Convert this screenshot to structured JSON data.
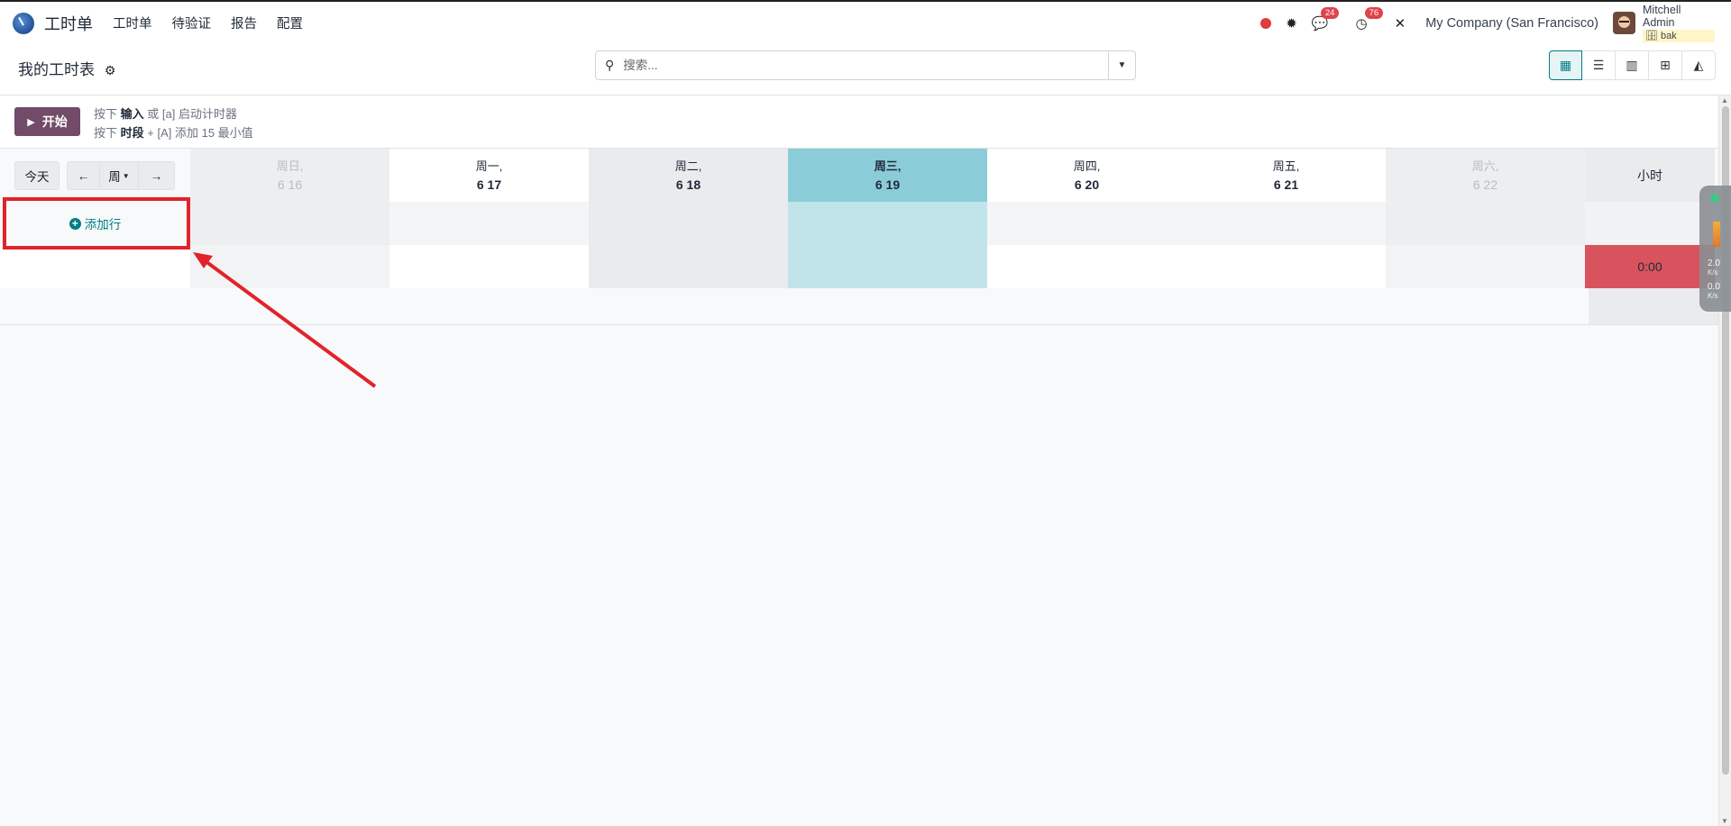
{
  "app": {
    "title": "工时单",
    "menu": [
      "工时单",
      "待验证",
      "报告",
      "配置"
    ]
  },
  "systray": {
    "messages_badge": "24",
    "activities_badge": "76",
    "company": "My Company (San Francisco)",
    "user_name": "Mitchell Admin",
    "db_name": "bak"
  },
  "controlpanel": {
    "title": "我的工时表",
    "search_placeholder": "搜索..."
  },
  "timer": {
    "start_label": "开始",
    "hint1_prefix": "按下",
    "hint1_key": "输入",
    "hint1_suffix": "或 [a] 启动计时器",
    "hint2_prefix": "按下",
    "hint2_key": "时段",
    "hint2_suffix": "+ [A] 添加 15 最小值"
  },
  "grid": {
    "today_label": "今天",
    "period_label": "周",
    "columns": [
      {
        "day": "周日,",
        "date": "6 16"
      },
      {
        "day": "周一,",
        "date": "6 17"
      },
      {
        "day": "周二,",
        "date": "6 18"
      },
      {
        "day": "周三,",
        "date": "6 19"
      },
      {
        "day": "周四,",
        "date": "6 20"
      },
      {
        "day": "周五,",
        "date": "6 21"
      },
      {
        "day": "周六,",
        "date": "6 22"
      }
    ],
    "total_header": "小时",
    "add_line_label": "添加行",
    "total_value": "0:00"
  },
  "net_widget": {
    "up": "2.0",
    "down": "0.0",
    "unit": "K/s"
  },
  "colors": {
    "brand": "#714b67",
    "accent": "#017e84",
    "today": "#8acdd9",
    "total_warning": "#d9535f",
    "annotation": "#e1232b"
  }
}
